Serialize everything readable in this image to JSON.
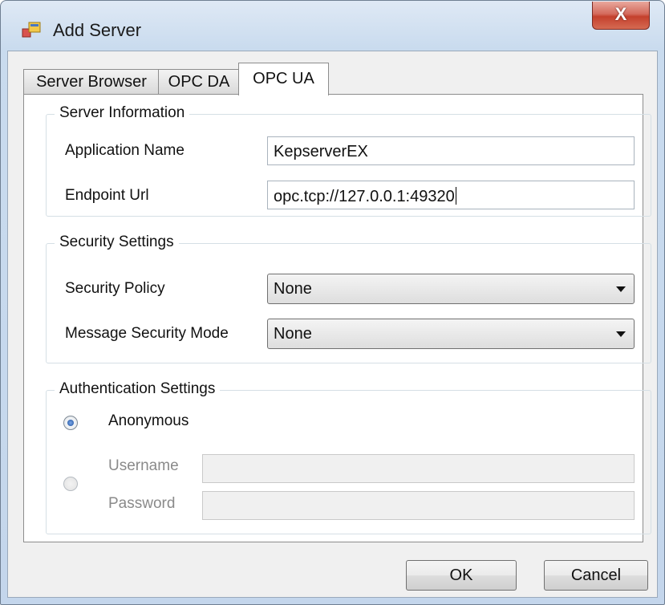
{
  "window": {
    "title": "Add Server",
    "close_label": "X"
  },
  "tabs": [
    {
      "label": "Server Browser"
    },
    {
      "label": "OPC DA"
    },
    {
      "label": "OPC UA",
      "selected": true
    }
  ],
  "server_information": {
    "title": "Server Information",
    "application_name_label": "Application Name",
    "application_name_value": "KepserverEX",
    "endpoint_url_label": "Endpoint Url",
    "endpoint_url_value": "opc.tcp://127.0.0.1:49320"
  },
  "security_settings": {
    "title": "Security Settings",
    "security_policy_label": "Security Policy",
    "security_policy_value": "None",
    "message_security_mode_label": "Message Security Mode",
    "message_security_mode_value": "None"
  },
  "authentication_settings": {
    "title": "Authentication Settings",
    "anonymous_label": "Anonymous",
    "anonymous_selected": true,
    "username_label": "Username",
    "username_value": "",
    "password_label": "Password",
    "password_value": ""
  },
  "buttons": {
    "ok": "OK",
    "cancel": "Cancel"
  },
  "colors": {
    "title_bar": "#c9dbee",
    "close_button": "#c4402d",
    "radio_selected": "#1d4f9c"
  },
  "icons": {
    "app": "add-server-app-icon",
    "close": "close-icon"
  }
}
